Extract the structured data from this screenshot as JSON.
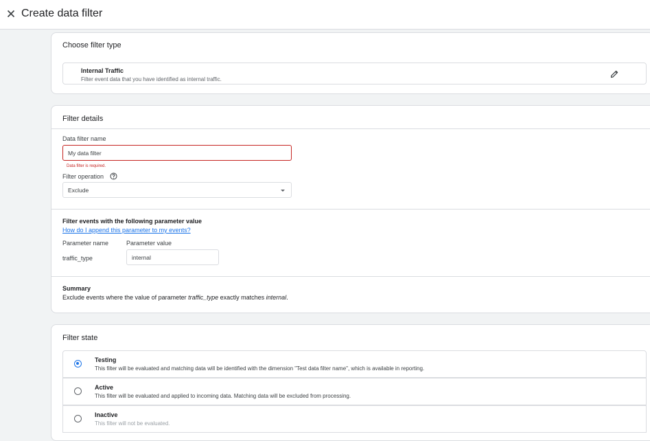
{
  "header": {
    "title": "Create data filter",
    "close_icon": "close-icon"
  },
  "filter_type": {
    "heading": "Choose filter type",
    "selected_title": "Internal Traffic",
    "selected_description": "Filter event data that you have identified as internal traffic.",
    "edit_icon": "pencil-icon"
  },
  "details": {
    "heading": "Filter details",
    "name_label": "Data filter name",
    "name_value": "My data filter",
    "name_error": "Data filter is required.",
    "operation_label": "Filter operation",
    "operation_help_icon": "help-circle-icon",
    "operation_value": "Exclude",
    "dropdown_icon": "caret-down-icon",
    "param_heading": "Filter events with the following parameter value",
    "param_help_link": "How do I append this parameter to my events?",
    "param_name_header": "Parameter name",
    "param_value_header": "Parameter value",
    "param_name": "traffic_type",
    "param_value": "internal",
    "summary_heading": "Summary",
    "summary_prefix": "Exclude events where the value of parameter ",
    "summary_param": "traffic_type",
    "summary_middle": " exactly matches ",
    "summary_value": "internal",
    "summary_suffix": "."
  },
  "state": {
    "heading": "Filter state",
    "options": [
      {
        "title": "Testing",
        "description": "This filter will be evaluated and matching data will be identified with the dimension \"Test data filter name\", which is available in reporting.",
        "selected": true
      },
      {
        "title": "Active",
        "description": "This filter will be evaluated and applied to incoming data. Matching data will be excluded from processing.",
        "selected": false
      },
      {
        "title": "Inactive",
        "description": "This filter will not be evaluated.",
        "selected": false
      }
    ]
  },
  "colors": {
    "accent": "#1a73e8",
    "error": "#c5221f",
    "border": "#dadce0",
    "background": "#f1f3f4"
  }
}
